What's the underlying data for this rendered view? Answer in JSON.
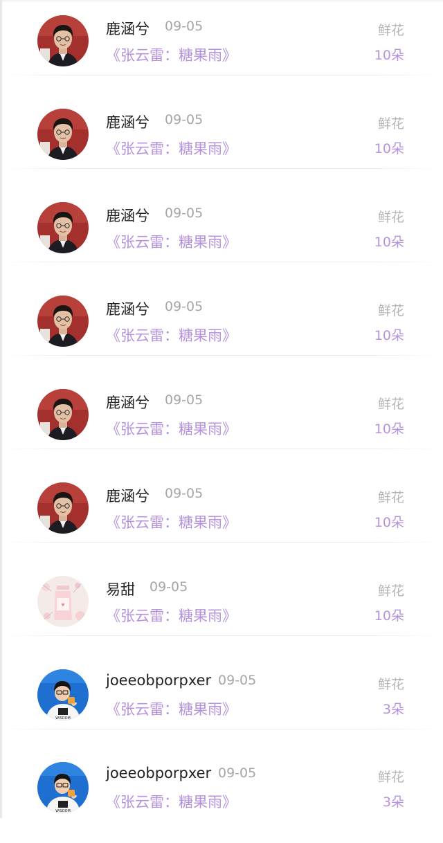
{
  "colors": {
    "title_purple": "#b693dc",
    "gift_label_gray": "#b5b5b5",
    "date_gray": "#a6a6a6",
    "name_dark": "#222222"
  },
  "rows": [
    {
      "name": "鹿涵兮",
      "date": "09-05",
      "title": "《张云雷：糖果雨》",
      "gift_label": "鲜花",
      "gift_count": "10朵",
      "avatar": "portrait-red-background"
    },
    {
      "name": "鹿涵兮",
      "date": "09-05",
      "title": "《张云雷：糖果雨》",
      "gift_label": "鲜花",
      "gift_count": "10朵",
      "avatar": "portrait-red-background"
    },
    {
      "name": "鹿涵兮",
      "date": "09-05",
      "title": "《张云雷：糖果雨》",
      "gift_label": "鲜花",
      "gift_count": "10朵",
      "avatar": "portrait-red-background"
    },
    {
      "name": "鹿涵兮",
      "date": "09-05",
      "title": "《张云雷：糖果雨》",
      "gift_label": "鲜花",
      "gift_count": "10朵",
      "avatar": "portrait-red-background"
    },
    {
      "name": "鹿涵兮",
      "date": "09-05",
      "title": "《张云雷：糖果雨》",
      "gift_label": "鲜花",
      "gift_count": "10朵",
      "avatar": "portrait-red-background"
    },
    {
      "name": "鹿涵兮",
      "date": "09-05",
      "title": "《张云雷：糖果雨》",
      "gift_label": "鲜花",
      "gift_count": "10朵",
      "avatar": "portrait-red-background"
    },
    {
      "name": "易甜",
      "date": "09-05",
      "title": "《张云雷：糖果雨》",
      "gift_label": "鲜花",
      "gift_count": "10朵",
      "avatar": "pink-drink-bottle"
    },
    {
      "name": "joeeobporpxer",
      "date": "09-05",
      "title": "《张云雷：糖果雨》",
      "gift_label": "鲜花",
      "gift_count": "3朵",
      "avatar": "cartoon-boy-blue-background"
    },
    {
      "name": "joeeobporpxer",
      "date": "09-05",
      "title": "《张云雷：糖果雨》",
      "gift_label": "鲜花",
      "gift_count": "3朵",
      "avatar": "cartoon-boy-blue-background"
    }
  ]
}
